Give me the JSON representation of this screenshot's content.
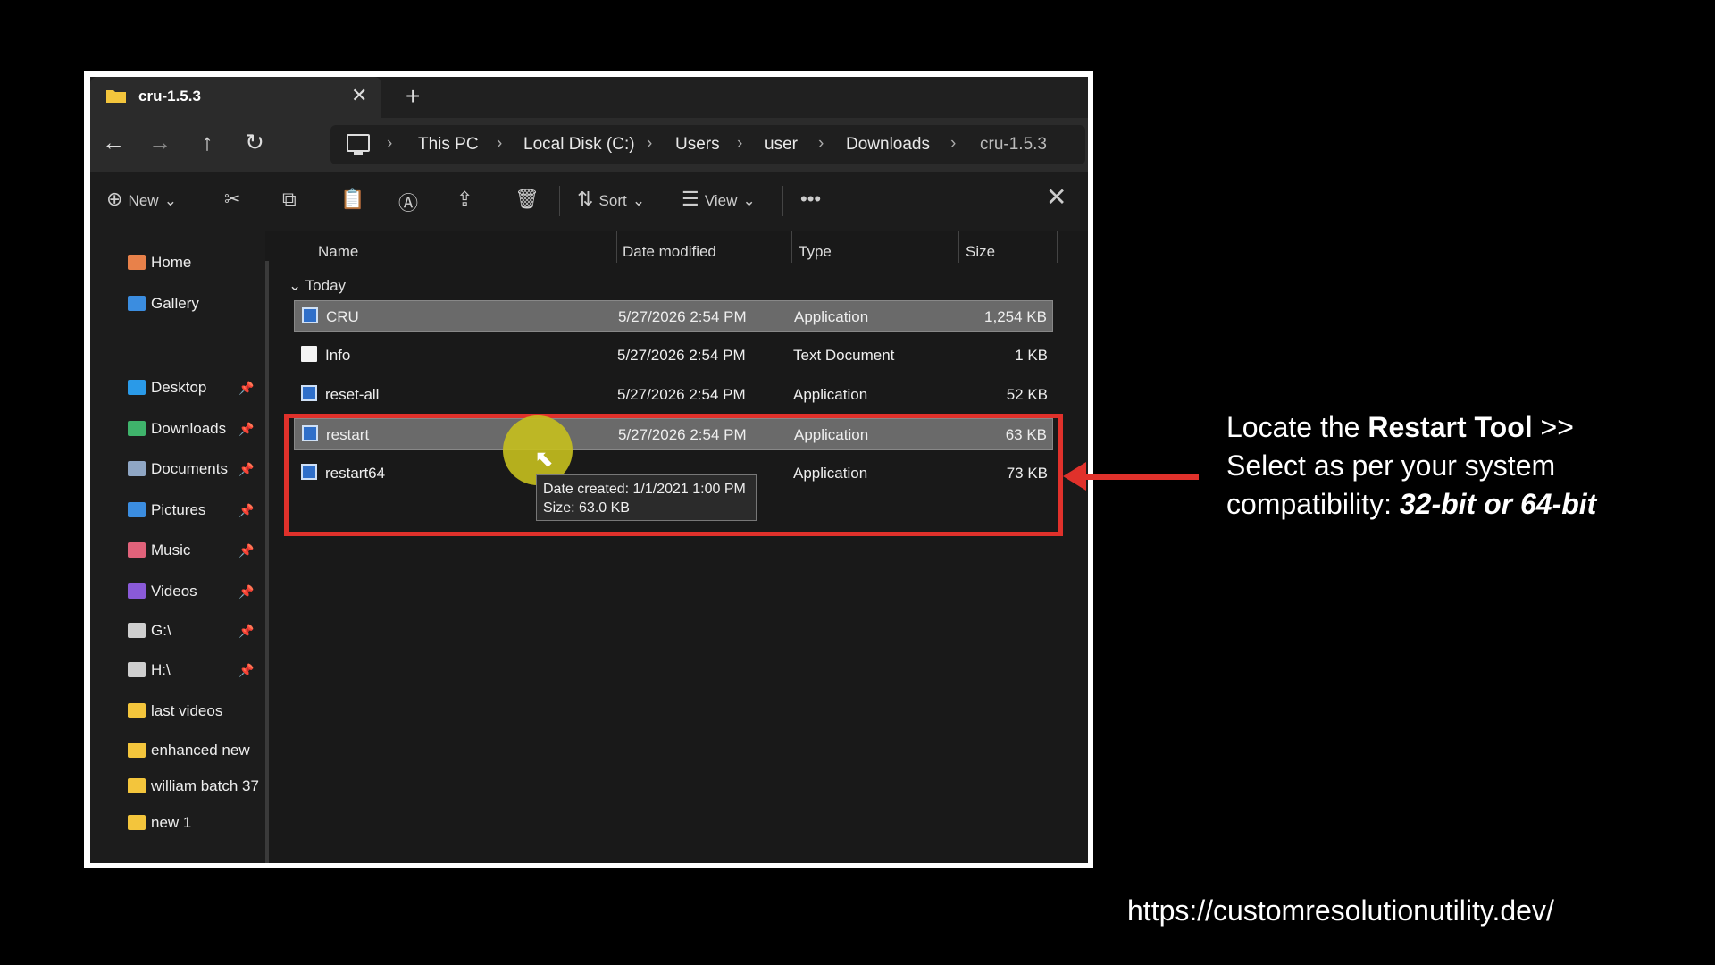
{
  "window": {
    "tab_title": "cru-1.5.3",
    "close_tab_icon": "close-icon",
    "new_tab_icon": "plus-icon"
  },
  "nav": {
    "breadcrumb": [
      "This PC",
      "Local Disk (C:)",
      "Users",
      "user",
      "Downloads",
      "cru-1.5.3"
    ]
  },
  "toolbar": {
    "new_label": "New",
    "sort_label": "Sort",
    "view_label": "View",
    "more_label": "•••"
  },
  "sidebar": {
    "top_items": [
      {
        "label": "Home",
        "icon": "home-icon",
        "color": "#e8814a"
      },
      {
        "label": "Gallery",
        "icon": "gallery-icon",
        "color": "#3b8de0"
      }
    ],
    "pinned_items": [
      {
        "label": "Desktop",
        "icon": "desktop-icon",
        "color": "#2a9ae8"
      },
      {
        "label": "Downloads",
        "icon": "download-icon",
        "color": "#3fb36b"
      },
      {
        "label": "Documents",
        "icon": "documents-icon",
        "color": "#8fa6c4"
      },
      {
        "label": "Pictures",
        "icon": "pictures-icon",
        "color": "#3b8de0"
      },
      {
        "label": "Music",
        "icon": "music-icon",
        "color": "#e0627a"
      },
      {
        "label": "Videos",
        "icon": "videos-icon",
        "color": "#8a5ad8"
      },
      {
        "label": "G:\\",
        "icon": "drive-icon",
        "color": "#cfcfcf"
      },
      {
        "label": "H:\\",
        "icon": "drive-icon",
        "color": "#cfcfcf"
      }
    ],
    "folders": [
      {
        "label": "last videos",
        "icon": "folder-icon",
        "color": "#f3c53c"
      },
      {
        "label": "enhanced new",
        "icon": "folder-icon",
        "color": "#f3c53c"
      },
      {
        "label": "william batch 37",
        "icon": "folder-icon",
        "color": "#f3c53c"
      },
      {
        "label": "new 1",
        "icon": "folder-icon",
        "color": "#f3c53c"
      }
    ]
  },
  "columns": {
    "name": "Name",
    "date": "Date modified",
    "type": "Type",
    "size": "Size"
  },
  "group_label": "Today",
  "files": [
    {
      "name": "CRU",
      "date": "5/27/2026 2:54 PM",
      "type": "Application",
      "size": "1,254 KB",
      "icon": "app-icon"
    },
    {
      "name": "Info",
      "date": "5/27/2026 2:54 PM",
      "type": "Text Document",
      "size": "1 KB",
      "icon": "text-file-icon"
    },
    {
      "name": "reset-all",
      "date": "5/27/2026 2:54 PM",
      "type": "Application",
      "size": "52 KB",
      "icon": "app-icon"
    },
    {
      "name": "restart",
      "date": "5/27/2026 2:54 PM",
      "type": "Application",
      "size": "63 KB",
      "icon": "app-icon"
    },
    {
      "name": "restart64",
      "date": "",
      "type": "Application",
      "size": "73 KB",
      "icon": "app-icon"
    }
  ],
  "tooltip": {
    "line1": "Date created: 1/1/2021 1:00 PM",
    "line2": "Size: 63.0 KB"
  },
  "caption": {
    "part1": "Locate the ",
    "bold": "Restart Tool",
    "part2": " >> Select as per your system compatibility: ",
    "bold_italic": "32-bit or 64-bit"
  },
  "url": "https://customresolutionutility.dev/",
  "colors": {
    "highlight": "#e0312b",
    "cursor_dot": "#c7c01e"
  }
}
